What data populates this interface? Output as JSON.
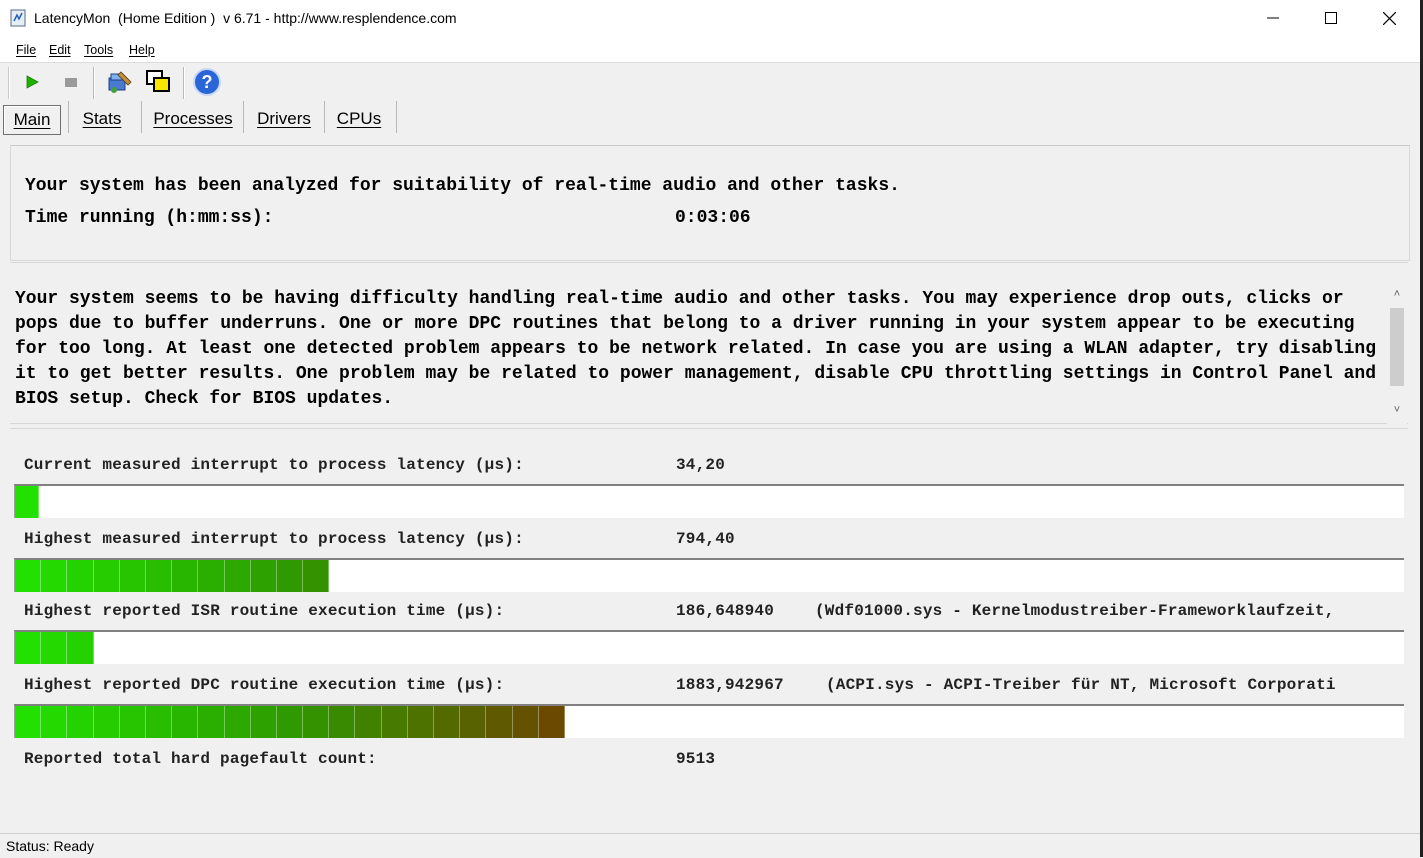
{
  "window": {
    "title": "LatencyMon  (Home Edition )  v 6.71 - http://www.resplendence.com",
    "icon": "latencymon-app-icon"
  },
  "menu": [
    "File",
    "Edit",
    "Tools",
    "Help"
  ],
  "toolbar": {
    "buttons": [
      "play-icon",
      "stop-icon",
      "driver-tool-icon",
      "window-layers-icon",
      "help-icon"
    ]
  },
  "tabs": {
    "main": "Main",
    "stats": "Stats",
    "processes": "Processes",
    "drivers": "Drivers",
    "cpus": "CPUs",
    "active": "Main"
  },
  "summary": {
    "analyzed_text": "Your system has been analyzed for suitability of real-time audio and other tasks.",
    "time_label": "Time running (h:mm:ss):",
    "time_value": "0:03:06"
  },
  "message": "Your system seems to be having difficulty handling real-time audio and other tasks. You may experience drop outs, clicks or pops due to buffer underruns. One or more DPC routines that belong to a driver running in your system appear to be executing for too long. At least one detected problem appears to be network related. In case you are using a WLAN adapter, try disabling it to get better results. One problem may be related to power management, disable CPU throttling settings in Control Panel and BIOS setup. Check for BIOS updates.",
  "metrics": [
    {
      "label": "Current measured interrupt to process latency (µs):",
      "value": "34,20",
      "detail": "",
      "bar_segments": 1
    },
    {
      "label": "Highest measured interrupt to process latency (µs):",
      "value": "794,40",
      "detail": "",
      "bar_segments": 12
    },
    {
      "label": "Highest reported ISR routine execution time (µs):",
      "value": "186,648940",
      "detail": "(Wdf01000.sys - Kernelmodustreiber-Frameworklaufzeit,",
      "bar_segments": 3
    },
    {
      "label": "Highest reported DPC routine execution time (µs):",
      "value": "1883,942967",
      "detail": "(ACPI.sys - ACPI-Treiber für NT, Microsoft Corporati",
      "bar_segments": 21
    }
  ],
  "pagefault": {
    "label": "Reported total hard pagefault count:",
    "value": "9513"
  },
  "status": "Status: Ready",
  "colors": {
    "bar_start": "#22e000",
    "bar_mid": "#2e9a00",
    "bar_end": "#6b4a00"
  }
}
